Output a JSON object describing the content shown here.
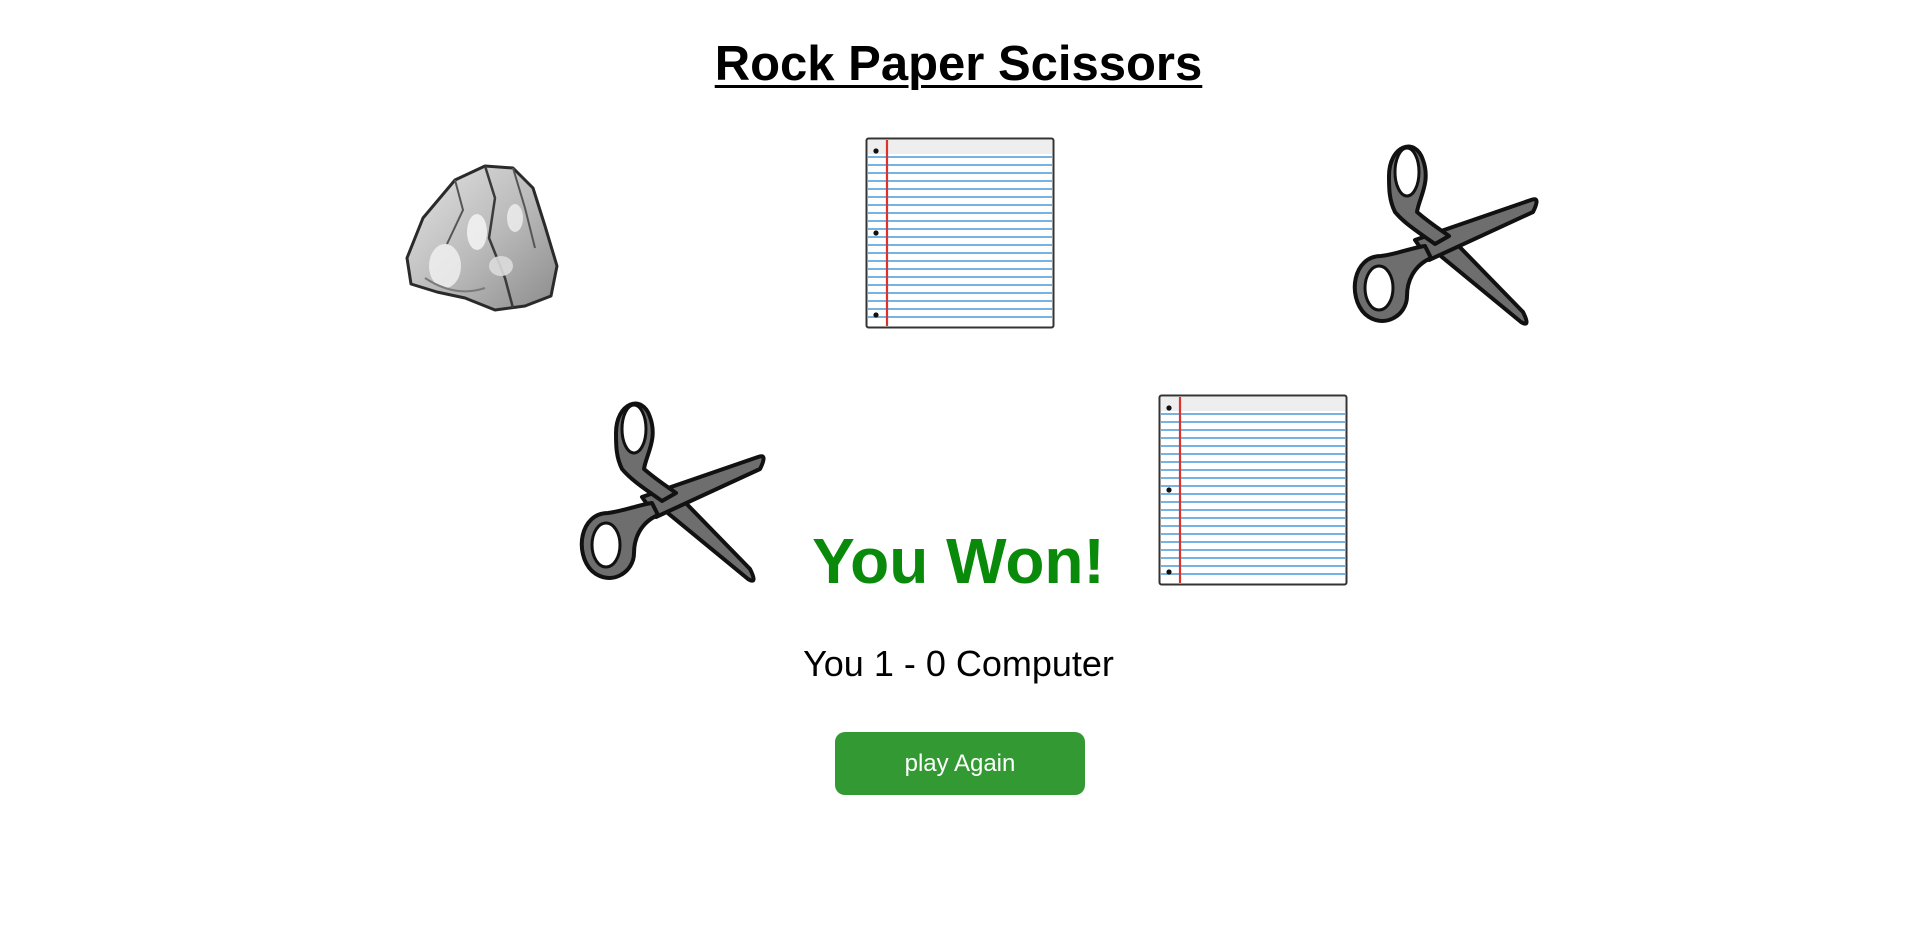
{
  "game": {
    "title": "Rock Paper Scissors",
    "choices": [
      {
        "id": "rock",
        "icon": "rock-icon"
      },
      {
        "id": "paper",
        "icon": "paper-icon"
      },
      {
        "id": "scissors",
        "icon": "scissors-icon"
      }
    ],
    "player_pick": "scissors",
    "computer_pick": "paper",
    "result_text": "You Won!",
    "score_text": "You 1 - 0 Computer",
    "play_again_label": "play Again"
  },
  "colors": {
    "result": "#0a8a0a",
    "button_bg": "#339933",
    "button_text": "#ffffff",
    "paper_lines": "#4a9ad8",
    "paper_margin": "#d9342b",
    "scissors_gray": "#6e6e6e"
  }
}
